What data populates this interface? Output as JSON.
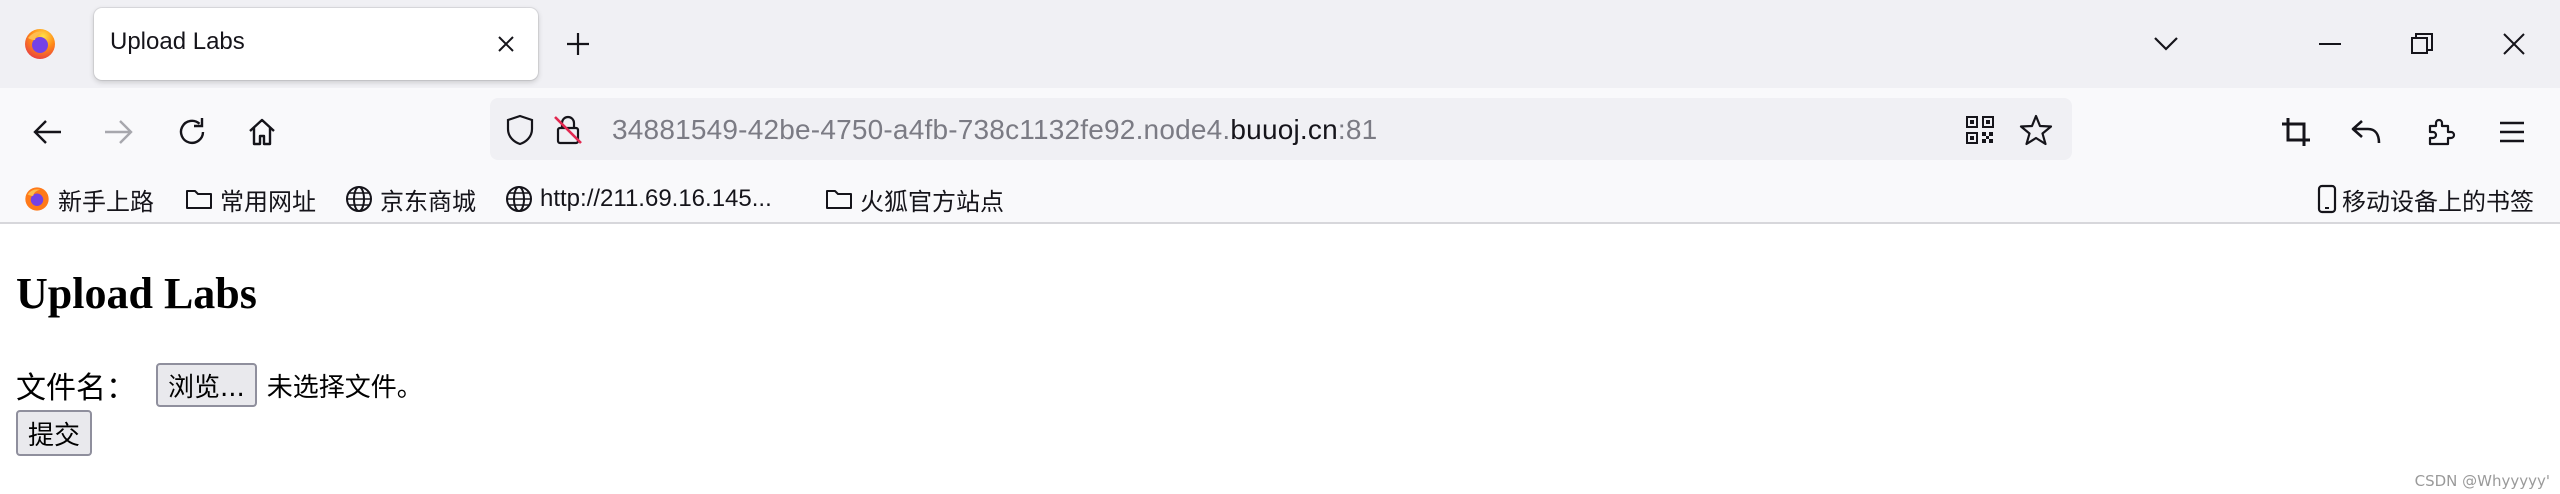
{
  "browser": {
    "tab": {
      "title": "Upload Labs"
    },
    "url": {
      "prefix": "34881549-42be-4750-a4fb-738c1132fe92.node4.",
      "domain": "buuoj.cn",
      "suffix": ":81"
    },
    "bookmarks": [
      {
        "label": "新手上路",
        "icon": "firefox-icon"
      },
      {
        "label": "常用网址",
        "icon": "folder-icon"
      },
      {
        "label": "京东商城",
        "icon": "globe-icon"
      },
      {
        "label": "http://211.69.16.145...",
        "icon": "globe-icon"
      },
      {
        "label": "火狐官方站点",
        "icon": "folder-icon"
      }
    ],
    "mobile_bookmarks": {
      "label": "移动设备上的书签",
      "icon": "mobile-device-icon"
    },
    "accent_color": "#0060df"
  },
  "page": {
    "heading": "Upload Labs",
    "file_label": "文件名：",
    "browse_label": "浏览...",
    "no_file_text": "未选择文件。",
    "submit_label": "提交",
    "watermark": "CSDN @Whyyyyy'"
  }
}
